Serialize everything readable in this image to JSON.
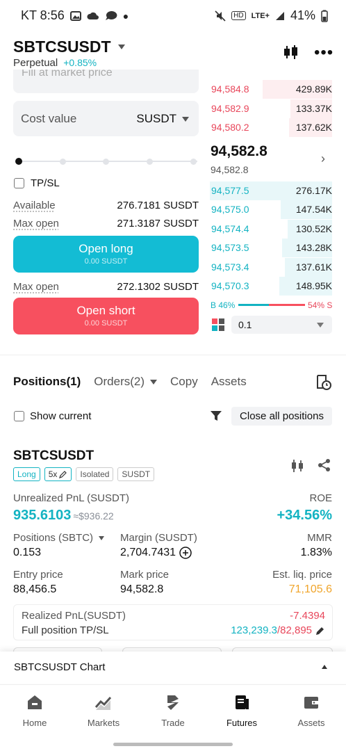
{
  "status": {
    "carrier_time": "KT 8:56",
    "battery": "41%",
    "network": "LTE+"
  },
  "header": {
    "pair": "SBTCSUSDT",
    "type": "Perpetual",
    "change": "+0.85%"
  },
  "form": {
    "price_placeholder": "Fill at market price",
    "cost_label": "Cost value",
    "cost_unit": "SUSDT",
    "tpsl_label": "TP/SL",
    "available_label": "Available",
    "available_value": "276.7181 SUSDT",
    "maxopen_label": "Max open",
    "maxopen_long_value": "271.3187 SUSDT",
    "open_long_label": "Open long",
    "open_long_sub": "0.00 SUSDT",
    "maxopen_short_value": "272.1302 SUSDT",
    "open_short_label": "Open short",
    "open_short_sub": "0.00 SUSDT"
  },
  "orderbook": {
    "asks": [
      {
        "price": "94,584.8",
        "qty": "429.89K"
      },
      {
        "price": "94,582.9",
        "qty": "133.37K"
      },
      {
        "price": "94,580.2",
        "qty": "137.62K"
      }
    ],
    "last_price": "94,582.8",
    "mark_price": "94,582.8",
    "bids": [
      {
        "price": "94,577.5",
        "qty": "276.17K"
      },
      {
        "price": "94,575.0",
        "qty": "147.54K"
      },
      {
        "price": "94,574.4",
        "qty": "130.52K"
      },
      {
        "price": "94,573.5",
        "qty": "143.28K"
      },
      {
        "price": "94,573.4",
        "qty": "137.61K"
      },
      {
        "price": "94,570.3",
        "qty": "148.95K"
      }
    ],
    "buy_ratio": "B 46%",
    "sell_ratio": "54% S",
    "precision": "0.1"
  },
  "tabs": {
    "positions": "Positions(1)",
    "orders": "Orders(2)",
    "copy": "Copy",
    "assets": "Assets"
  },
  "filter": {
    "show_current": "Show current",
    "close_all": "Close all positions"
  },
  "position": {
    "symbol": "SBTCSUSDT",
    "tags": [
      "Long",
      "5x",
      "Isolated",
      "SUSDT"
    ],
    "upnl_label": "Unrealized PnL (SUSDT)",
    "upnl_value": "935.6103",
    "upnl_approx": "≈$936.22",
    "roe_label": "ROE",
    "roe_value": "+34.56%",
    "size_label": "Positions (SBTC)",
    "size_value": "0.153",
    "margin_label": "Margin (SUSDT)",
    "margin_value": "2,704.7431",
    "mmr_label": "MMR",
    "mmr_value": "1.83%",
    "entry_label": "Entry price",
    "entry_value": "88,456.5",
    "mark_label": "Mark price",
    "mark_value": "94,582.8",
    "liq_label": "Est. liq. price",
    "liq_value": "71,105.6",
    "realized_label": "Realized PnL(SUSDT)",
    "realized_value": "-7.4394",
    "tpsl_label": "Full position TP/SL",
    "tp_value": "123,239.3",
    "sl_value": "/82,895"
  },
  "chart_bar": {
    "label": "SBTCSUSDT Chart"
  },
  "nav": {
    "home": "Home",
    "markets": "Markets",
    "trade": "Trade",
    "futures": "Futures",
    "assets": "Assets"
  },
  "colors": {
    "long": "#13b3c2",
    "short": "#f7505f",
    "liq": "#f0a52b"
  }
}
